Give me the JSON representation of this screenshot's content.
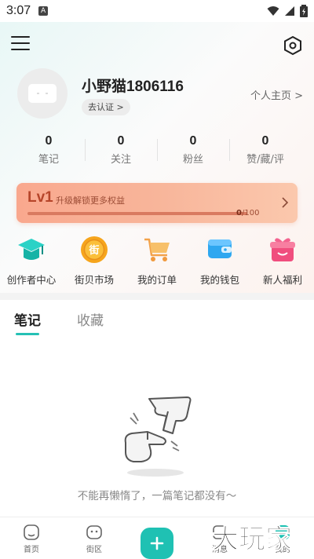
{
  "status_bar": {
    "time": "3:07",
    "notification_badge": "A"
  },
  "profile": {
    "username": "小野猫1806116",
    "verify_label": "去认证 >",
    "homepage_label": "个人主页 >"
  },
  "stats": [
    {
      "value": "0",
      "label": "笔记"
    },
    {
      "value": "0",
      "label": "关注"
    },
    {
      "value": "0",
      "label": "粉丝"
    },
    {
      "value": "0",
      "label": "赞/藏/评"
    }
  ],
  "level": {
    "title": "Lv1",
    "tip": "升级解锁更多权益",
    "current": "0",
    "total": "/100",
    "progress_fraction": 0
  },
  "tools": [
    {
      "label": "创作者中心",
      "icon": "graduation-cap-icon"
    },
    {
      "label": "街贝市场",
      "icon": "coin-icon"
    },
    {
      "label": "我的订单",
      "icon": "cart-icon"
    },
    {
      "label": "我的钱包",
      "icon": "wallet-icon"
    },
    {
      "label": "新人福利",
      "icon": "gift-icon"
    }
  ],
  "tabs": [
    {
      "label": "笔记",
      "active": true
    },
    {
      "label": "收藏",
      "active": false
    }
  ],
  "empty_state": {
    "text": "不能再懒惰了，一篇笔记都没有～"
  },
  "bottom_nav": [
    {
      "label": "首页"
    },
    {
      "label": "街区"
    },
    {
      "label": ""
    },
    {
      "label": "消息"
    },
    {
      "label": "我的"
    }
  ],
  "watermark": {
    "text": "大玩家"
  },
  "colors": {
    "accent": "#1fc1b3",
    "level_card": "#f9a88e",
    "level_text": "#b6452a"
  },
  "coin_glyph": "街"
}
